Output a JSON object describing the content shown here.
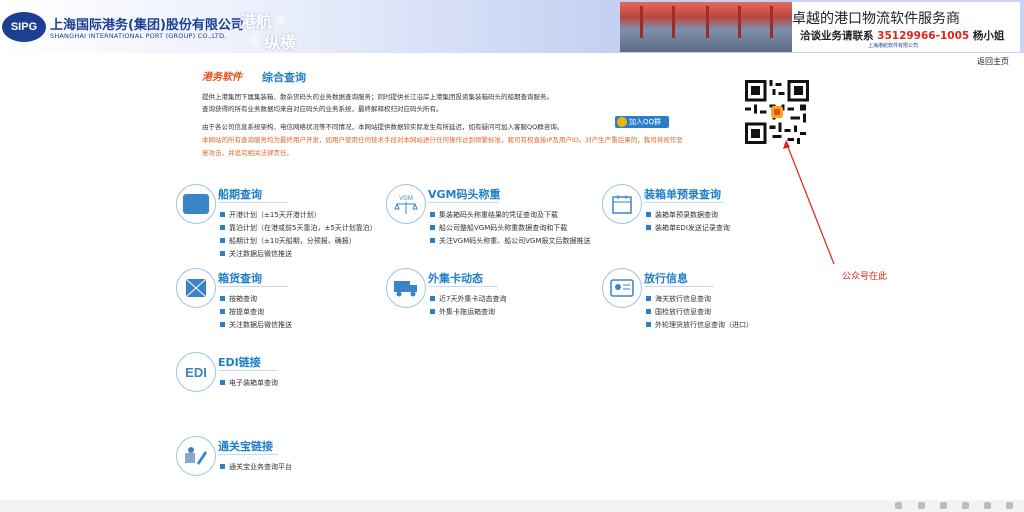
{
  "header": {
    "logo_abbr": "SIPG",
    "company_cn": "上海国际港务(集团)股份有限公司",
    "company_en": "SHANGHAI INTERNATIONAL PORT (GROUP) CO.,LTD.",
    "slogan_a": "港航",
    "slogan_b": "通",
    "slogan_c": "任",
    "slogan_d": "纵横"
  },
  "ad": {
    "title": "卓越的港口物流软件服务商",
    "sub_prefix": "洽谈业务请联系",
    "phone": "35129966-1005",
    "contact": "杨小姐",
    "tiny": "上海港航软件有限公司"
  },
  "home_link": "返回主页",
  "intro": {
    "brand": "港务软件",
    "title": "综合查询",
    "lines": [
      "提供上港集团下属集装箱、散杂货码头的业务数据查询服务；同时提供长江沿岸上港集团投资集装箱码头的船期查询服务。",
      "查询获得的所有业务数据均来自对应码头的业务系统，最终解释权归对应码头所有。",
      "由于各公司信息系统架构、电信网络状况等不同情况，本网站提供数据较实际发生有所延迟，如有疑问可加入客服QQ群咨询。"
    ],
    "warn": [
      "本网站的所有查询服务均为最终用户开发，如用户使用任何技术手段对本网站进行任何操作达到频繁标准，我司有权直接IP及用户ID。对产生严重后果的，我司将视作恶",
      "意攻击，并追究相关法律责任。"
    ],
    "qq_button": "加入QQ群"
  },
  "annotation": "公众号在此",
  "categories": [
    {
      "title": "船期查询",
      "items": [
        "开港计划（±15天开港计划）",
        "靠泊计划（在港或前5天靠泊，±5天计划靠泊）",
        "船期计划（±10天船期，分预报、确报）",
        "关注数据后微信推送"
      ]
    },
    {
      "title": "VGM码头称重",
      "items": [
        "集装箱码头称重结果的凭证查询及下载",
        "船公司整船VGM码头称重数据查询和下载",
        "关注VGM码头称重、船公司VGM报文后数据推送"
      ]
    },
    {
      "title": "装箱单预录查询",
      "items": [
        "装箱单预录数据查询",
        "装箱单EDI发送记录查询"
      ]
    },
    {
      "title": "箱货查询",
      "items": [
        "按箱查询",
        "按提单查询",
        "关注数据后微信推送"
      ]
    },
    {
      "title": "外集卡动态",
      "items": [
        "近7天外集卡动态查询",
        "外集卡拖运箱查询"
      ]
    },
    {
      "title": "放行信息",
      "items": [
        "海关放行信息查询",
        "国检放行信息查询",
        "外轮理货放行信息查询（进口）"
      ]
    },
    {
      "title": "EDI链接",
      "items": [
        "电子装箱单查询"
      ]
    },
    {
      "title": "通关宝链接",
      "items": [
        "通关宝业务查询平台"
      ]
    }
  ],
  "icon_labels": {
    "vgm": "VGM",
    "edi": "EDI"
  },
  "colors": {
    "accent": "#1f7fc8",
    "brand": "#1d3f93",
    "warn": "#e06a2a",
    "annotation": "#e2231a"
  }
}
